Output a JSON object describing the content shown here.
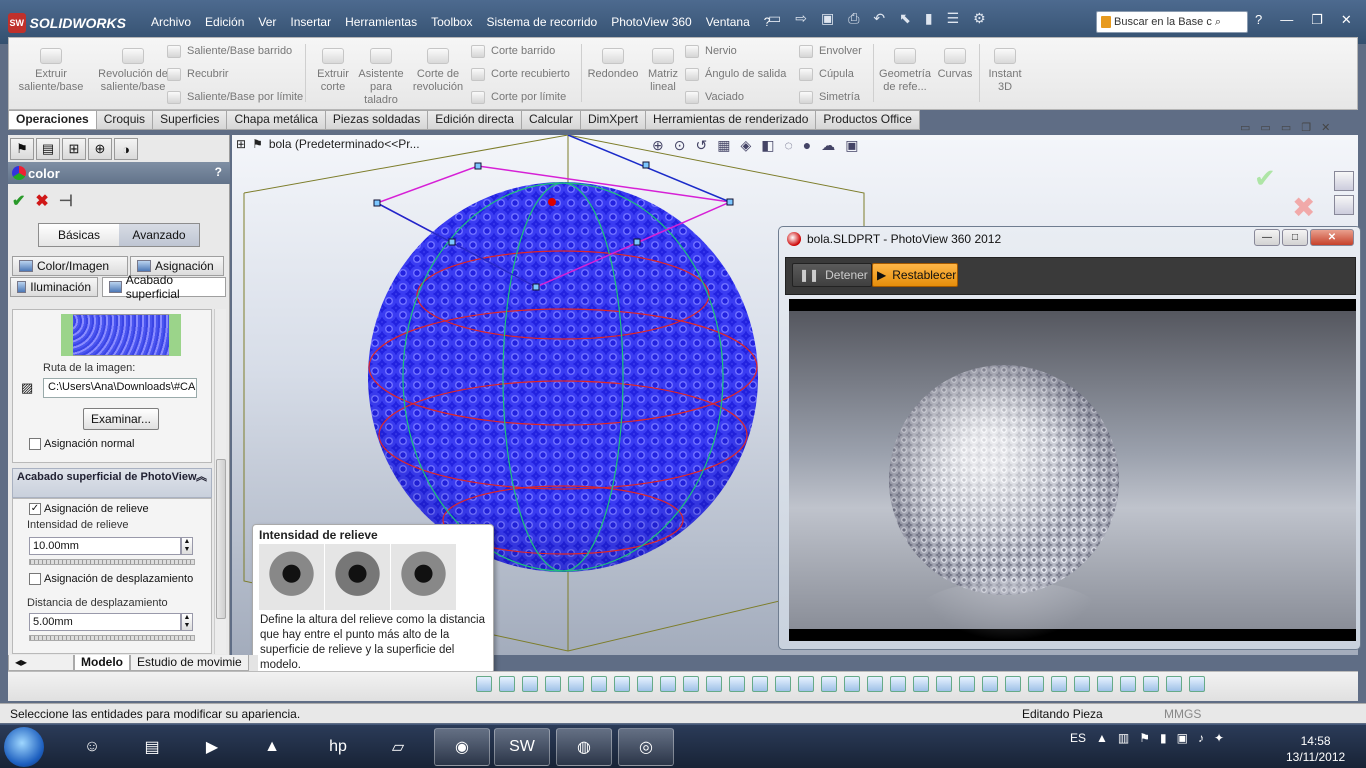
{
  "app": {
    "logo": "SOLIDWORKS",
    "logo_mark": "SW"
  },
  "menu": [
    "Archivo",
    "Edición",
    "Ver",
    "Insertar",
    "Herramientas",
    "Toolbox",
    "Sistema de recorrido",
    "PhotoView 360",
    "Ventana",
    "?"
  ],
  "search": {
    "placeholder": "Buscar en la Base c"
  },
  "commands": {
    "extrude_boss": "Extruir saliente/base",
    "revolve_boss": "Revolución de saliente/base",
    "swept_boss": "Saliente/Base barrido",
    "loft_boss": "Recubrir",
    "boundary_boss": "Saliente/Base por límite",
    "extrude_cut": "Extruir corte",
    "hole_wizard": "Asistente para taladro",
    "revolve_cut": "Corte de revolución",
    "swept_cut": "Corte barrido",
    "loft_cut": "Corte recubierto",
    "boundary_cut": "Corte por límite",
    "fillet": "Redondeo",
    "linear_pattern": "Matriz lineal",
    "rib": "Nervio",
    "draft": "Ángulo de salida",
    "shell": "Vaciado",
    "wrap": "Envolver",
    "dome": "Cúpula",
    "mirror": "Simetría",
    "ref_geometry": "Geometría de refe...",
    "curves": "Curvas",
    "instant3d": "Instant 3D"
  },
  "tabs": [
    "Operaciones",
    "Croquis",
    "Superficies",
    "Chapa metálica",
    "Piezas soldadas",
    "Edición directa",
    "Calcular",
    "DimXpert",
    "Herramientas de renderizado",
    "Productos Office"
  ],
  "panel": {
    "title": "color",
    "help": "?",
    "ok": "✔",
    "cancel": "✖",
    "pin": "⊣",
    "mode_basic": "Básicas",
    "mode_advanced": "Avanzado",
    "subtabs": [
      "Color/Imagen",
      "Asignación",
      "Iluminación",
      "Acabado superficial"
    ],
    "image_path_label": "Ruta de la imagen:",
    "image_path_value": "C:\\Users\\Ana\\Downloads\\#CA",
    "browse": "Examinar...",
    "normal_mapping": "Asignación normal",
    "pv_section": "Acabado superficial de PhotoView",
    "bump_mapping": "Asignación de relieve",
    "bump_intensity_label": "Intensidad de relieve",
    "bump_intensity_value": "10.00mm",
    "displacement_mapping": "Asignación de desplazamiento",
    "displacement_distance_label": "Distancia de desplazamiento",
    "displacement_distance_value": "5.00mm"
  },
  "viewport": {
    "tree_label": "bola  (Predeterminado<<Pr..."
  },
  "tooltip": {
    "title": "Intensidad de relieve",
    "text": "Define la altura del relieve como la distancia que hay entre el punto más alto de la superficie de relieve y la superficie del modelo."
  },
  "photoview": {
    "title": "bola.SLDPRT - PhotoView 360 2012",
    "stop": "Detener",
    "reset": "Restablecer"
  },
  "bottom_tabs": [
    "Modelo",
    "Estudio de movimie"
  ],
  "status": {
    "message": "Seleccione las entidades para modificar su apariencia.",
    "mode": "Editando Pieza",
    "units": "MMGS"
  },
  "taskbar": {
    "lang": "ES",
    "time": "14:58",
    "date": "13/11/2012"
  },
  "colors": {
    "titlebar": "#3f5c80",
    "sphere": "#3b3df0",
    "accent_orange": "#f5a02a"
  }
}
